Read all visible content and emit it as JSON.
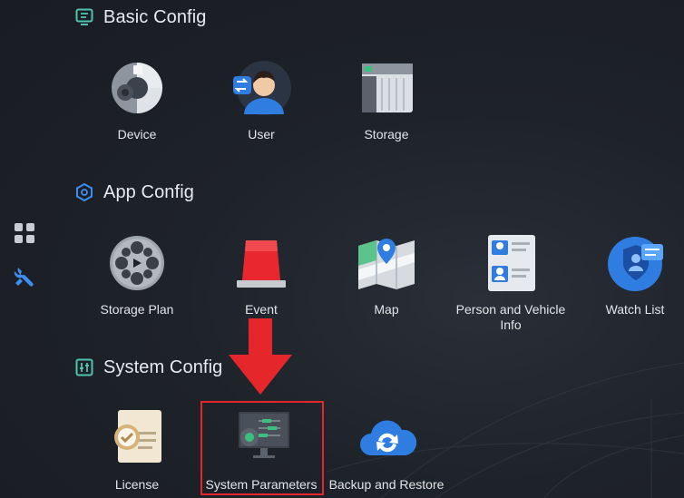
{
  "sidebar": {
    "items": [
      {
        "name": "apps-grid-icon",
        "color": "#c9ccd1"
      },
      {
        "name": "wrench-icon",
        "color": "#3d8ef0"
      }
    ]
  },
  "sections": {
    "basic": {
      "title": "Basic Config",
      "tiles": {
        "device": "Device",
        "user": "User",
        "storage": "Storage"
      }
    },
    "app": {
      "title": "App Config",
      "tiles": {
        "storage_plan": "Storage Plan",
        "event": "Event",
        "map": "Map",
        "person_vehicle_line1": "Person and Vehicle",
        "person_vehicle_line2": "Info",
        "watch_list": "Watch List"
      }
    },
    "system": {
      "title": "System Config",
      "tiles": {
        "license": "License",
        "system_parameters": "System Parameters",
        "backup_restore": "Backup and Restore"
      }
    }
  },
  "annotation": {
    "highlight_color": "#e5262a",
    "arrow_color": "#e5262a",
    "target": "System Parameters"
  }
}
